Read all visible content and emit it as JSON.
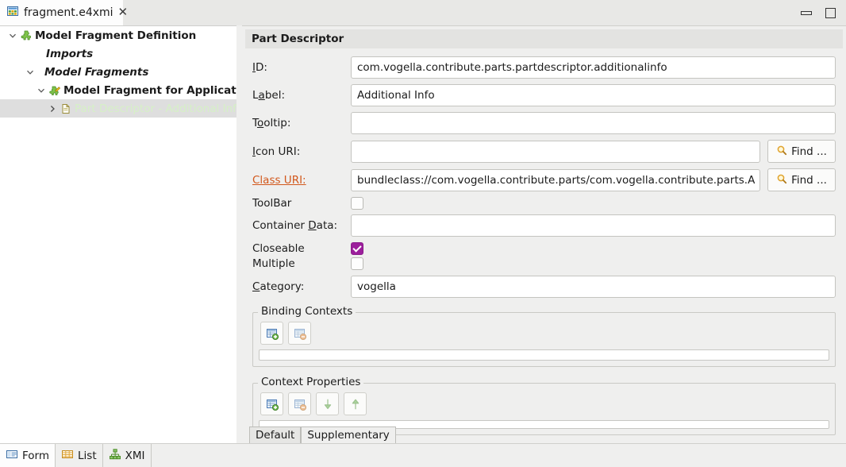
{
  "window": {
    "tab_title": "fragment.e4xmi",
    "tab_close": "✕",
    "minimize_icon": "minimize-icon",
    "maximize_icon": "maximize-icon"
  },
  "tree": {
    "items": [
      {
        "label": "Model Fragment Definition",
        "icon": "puzzle-icon",
        "expanded": true,
        "style": "bold",
        "indent": 0
      },
      {
        "label": "Imports",
        "icon": "none",
        "expanded": null,
        "style": "bold-italic",
        "indent": 1
      },
      {
        "label": "Model Fragments",
        "icon": "none",
        "expanded": true,
        "style": "bold-italic",
        "indent": 1
      },
      {
        "label": "Model Fragment for Application -",
        "icon": "puzzle-edit-icon",
        "expanded": true,
        "style": "bold",
        "indent": 2
      },
      {
        "label": "Part Descriptor - Additional Inf",
        "icon": "file-icon",
        "expanded": false,
        "style": "selected",
        "indent": 3
      }
    ]
  },
  "form": {
    "header": "Part Descriptor",
    "fields": {
      "id": {
        "label": "ID:",
        "mnemonic": "I",
        "value": "com.vogella.contribute.parts.partdescriptor.additionalinfo"
      },
      "label": {
        "label": "Label:",
        "mnemonic": "a",
        "value": "Additional Info"
      },
      "tooltip": {
        "label": "Tooltip:",
        "mnemonic": "o",
        "value": ""
      },
      "icon_uri": {
        "label": "Icon URI:",
        "mnemonic": "I",
        "value": "",
        "button": "Find ..."
      },
      "class_uri": {
        "label": "Class URI:",
        "is_link": true,
        "value": "bundleclass://com.vogella.contribute.parts/com.vogella.contribute.parts.A",
        "button": "Find ..."
      },
      "toolbar": {
        "label": "ToolBar",
        "checked": false
      },
      "container_data": {
        "label": "Container Data:",
        "mnemonic": "D",
        "value": ""
      },
      "closeable": {
        "label": "Closeable",
        "checked": true
      },
      "multiple": {
        "label": "Multiple",
        "checked": false
      },
      "category": {
        "label": "Category:",
        "mnemonic": "C",
        "value": "vogella"
      }
    },
    "binding_contexts": {
      "title": "Binding Contexts",
      "buttons": [
        {
          "name": "add-binding-context-button",
          "icon": "table-add-icon"
        },
        {
          "name": "remove-binding-context-button",
          "icon": "table-remove-icon"
        }
      ]
    },
    "context_properties": {
      "title": "Context Properties",
      "buttons": [
        {
          "name": "add-context-property-button",
          "icon": "table-add-icon"
        },
        {
          "name": "remove-context-property-button",
          "icon": "table-remove-icon"
        },
        {
          "name": "move-down-button",
          "icon": "arrow-down-icon"
        },
        {
          "name": "move-up-button",
          "icon": "arrow-up-icon"
        }
      ]
    },
    "inner_tabs": [
      {
        "label": "Default",
        "active": true
      },
      {
        "label": "Supplementary",
        "active": false
      }
    ]
  },
  "bottom_tabs": [
    {
      "label": "Form",
      "icon": "form-icon",
      "active": true
    },
    {
      "label": "List",
      "icon": "table-icon",
      "active": false
    },
    {
      "label": "XMI",
      "icon": "hierarchy-icon",
      "active": false
    }
  ],
  "colors": {
    "accent_link": "#d2581c",
    "checkbox_checked": "#9c1f9c",
    "selection_bg": "#dedede",
    "selected_text": "#d6f0c6"
  }
}
